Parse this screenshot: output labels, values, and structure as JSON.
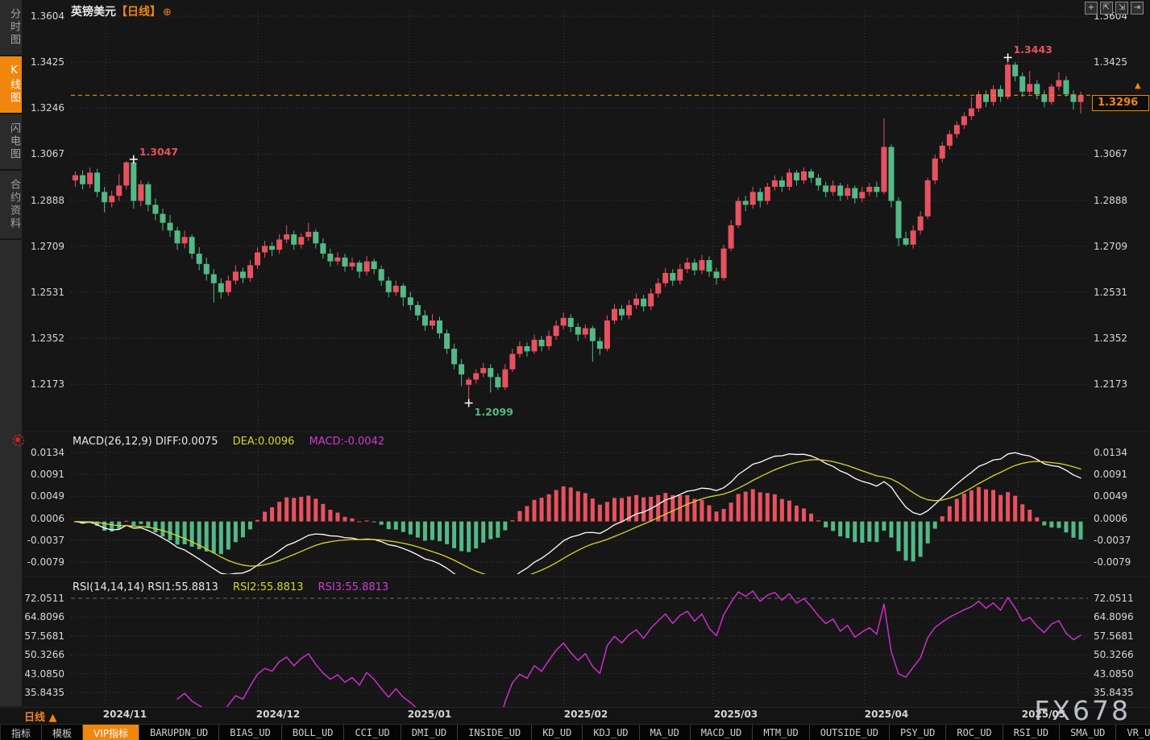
{
  "app": {
    "watermark": "FX678"
  },
  "colors": {
    "background": "#161616",
    "up": "#e8515f",
    "down": "#53b987",
    "accent_orange": "#f0860d",
    "dea_yellow": "#d6d62a",
    "magenta": "#cc2ecc",
    "diff_white": "#ffffff",
    "grid": "#3d3d3d",
    "axis_text": "#d8d8d8",
    "watermark": "#c9ced6"
  },
  "sidebar": {
    "tabs": [
      {
        "label": "分时图",
        "active": false
      },
      {
        "label": "K线图",
        "active": true
      },
      {
        "label": "闪电图",
        "active": false
      },
      {
        "label": "合约资料",
        "active": false
      }
    ]
  },
  "header": {
    "symbol": "英镑美元",
    "period_tag": "【日线】",
    "add_icon": "⊕"
  },
  "topbar_icons": [
    {
      "name": "crosshair-move-icon",
      "glyph": "+"
    },
    {
      "name": "zoom-axis-left-icon",
      "glyph": "⇱"
    },
    {
      "name": "zoom-axis-right-icon",
      "glyph": "⇲"
    },
    {
      "name": "exit-chart-icon",
      "glyph": "⇥"
    }
  ],
  "price_axis": {
    "ticks": [
      "1.3604",
      "1.3425",
      "1.3246",
      "1.3067",
      "1.2888",
      "1.2709",
      "1.2531",
      "1.2352",
      "1.2173"
    ]
  },
  "macd_panel": {
    "label_main": "MACD(26,12,9) DIFF:0.0075",
    "label_dea": "DEA:0.0096",
    "label_macd": "MACD:-0.0042",
    "ticks": [
      "0.0134",
      "0.0091",
      "0.0049",
      "0.0006",
      "-0.0037",
      "-0.0079"
    ]
  },
  "rsi_panel": {
    "label_main": "RSI(14,14,14) RSI1:55.8813",
    "label_rsi2": "RSI2:55.8813",
    "label_rsi3": "RSI3:55.8813",
    "ticks": [
      "72.0511",
      "64.8096",
      "57.5681",
      "50.3266",
      "43.0850",
      "35.8435"
    ]
  },
  "time_axis": {
    "period_label": "日线",
    "period_arrow": "▲",
    "dates": [
      "2024/11",
      "2024/12",
      "2025/01",
      "2025/02",
      "2025/03",
      "2025/04",
      "2025/05"
    ]
  },
  "toolbar": {
    "buttons": [
      {
        "label": "指标",
        "cjk": true,
        "active": false
      },
      {
        "label": "模板",
        "cjk": true,
        "active": false
      },
      {
        "label": "VIP指标",
        "cjk": true,
        "active": true
      },
      {
        "label": "BARUPDN_UD"
      },
      {
        "label": "BIAS_UD"
      },
      {
        "label": "BOLL_UD"
      },
      {
        "label": "CCI_UD"
      },
      {
        "label": "DMI_UD"
      },
      {
        "label": "INSIDE_UD"
      },
      {
        "label": "KD_UD"
      },
      {
        "label": "KDJ_UD"
      },
      {
        "label": "MA_UD"
      },
      {
        "label": "MACD_UD"
      },
      {
        "label": "MTM_UD"
      },
      {
        "label": "OUTSIDE_UD"
      },
      {
        "label": "PSY_UD"
      },
      {
        "label": "ROC_UD"
      },
      {
        "label": "RSI_UD"
      },
      {
        "label": "SMA_UD"
      },
      {
        "label": "VR_UD"
      },
      {
        "label": ">>"
      }
    ]
  },
  "main_chart": {
    "last_price_label": "1.3296",
    "annotations": [
      {
        "text": "1.3047",
        "candle": 8,
        "anchor": "high",
        "color": "#e8515f"
      },
      {
        "text": "1.3443",
        "candle": 128,
        "anchor": "high",
        "color": "#e8515f"
      },
      {
        "text": "1.2099",
        "candle": 54,
        "anchor": "low",
        "color": "#53b987"
      }
    ]
  },
  "chart_data": {
    "type": "candlestick",
    "title": "英镑美元 GBP/USD 日线 (daily)",
    "x_range": [
      "2024/10 late",
      "2025/05 early"
    ],
    "price_axis_ticks": [
      1.3604,
      1.3425,
      1.3246,
      1.3067,
      1.2888,
      1.2709,
      1.2531,
      1.2352,
      1.2173
    ],
    "marked_high": 1.3443,
    "marked_low": 1.2099,
    "last_price": 1.3296,
    "legend_note": "red = up candle, green = down candle (CN convention)",
    "indicators": {
      "macd": {
        "params": [
          26,
          12,
          9
        ],
        "diff": 0.0075,
        "dea": 0.0096,
        "macd": -0.0042,
        "axis_ticks": [
          0.0134,
          0.0091,
          0.0049,
          0.0006,
          -0.0037,
          -0.0079
        ]
      },
      "rsi": {
        "params": [
          14,
          14,
          14
        ],
        "rsi1": 55.8813,
        "rsi2": 55.8813,
        "rsi3": 55.8813,
        "axis_ticks": [
          72.0511,
          64.8096,
          57.5681,
          50.3266,
          43.085,
          35.8435
        ]
      }
    },
    "candles_format": [
      "open",
      "high",
      "low",
      "close"
    ],
    "candles": [
      [
        1.2965,
        1.3,
        1.294,
        1.2985
      ],
      [
        1.2985,
        1.3005,
        1.293,
        1.295
      ],
      [
        1.295,
        1.3015,
        1.2935,
        1.2995
      ],
      [
        1.2995,
        1.301,
        1.29,
        1.292
      ],
      [
        1.292,
        1.294,
        1.284,
        1.288
      ],
      [
        1.288,
        1.2925,
        1.286,
        1.2905
      ],
      [
        1.2905,
        1.299,
        1.2885,
        1.2945
      ],
      [
        1.2945,
        1.304,
        1.293,
        1.3035
      ],
      [
        1.3035,
        1.3047,
        1.2855,
        1.2885
      ],
      [
        1.2885,
        1.2965,
        1.2865,
        1.295
      ],
      [
        1.295,
        1.296,
        1.2845,
        1.287
      ],
      [
        1.287,
        1.2895,
        1.281,
        1.2835
      ],
      [
        1.2835,
        1.2855,
        1.277,
        1.28
      ],
      [
        1.28,
        1.283,
        1.2745,
        1.277
      ],
      [
        1.277,
        1.2785,
        1.2695,
        1.272
      ],
      [
        1.272,
        1.277,
        1.27,
        1.2745
      ],
      [
        1.2745,
        1.2755,
        1.266,
        1.268
      ],
      [
        1.268,
        1.2705,
        1.2615,
        1.264
      ],
      [
        1.264,
        1.2665,
        1.2575,
        1.26
      ],
      [
        1.26,
        1.262,
        1.249,
        1.2565
      ],
      [
        1.2565,
        1.2585,
        1.2505,
        1.253
      ],
      [
        1.253,
        1.2595,
        1.2515,
        1.2575
      ],
      [
        1.2575,
        1.2635,
        1.256,
        1.261
      ],
      [
        1.261,
        1.2625,
        1.2565,
        1.2585
      ],
      [
        1.2585,
        1.2655,
        1.257,
        1.2635
      ],
      [
        1.2635,
        1.2705,
        1.262,
        1.2685
      ],
      [
        1.2685,
        1.273,
        1.2665,
        1.271
      ],
      [
        1.271,
        1.2725,
        1.267,
        1.2695
      ],
      [
        1.2695,
        1.2755,
        1.268,
        1.2735
      ],
      [
        1.2735,
        1.279,
        1.272,
        1.2755
      ],
      [
        1.2755,
        1.277,
        1.2695,
        1.2715
      ],
      [
        1.2715,
        1.276,
        1.27,
        1.2745
      ],
      [
        1.2745,
        1.28,
        1.273,
        1.2765
      ],
      [
        1.2765,
        1.2775,
        1.27,
        1.272
      ],
      [
        1.272,
        1.274,
        1.266,
        1.268
      ],
      [
        1.268,
        1.27,
        1.263,
        1.265
      ],
      [
        1.265,
        1.2685,
        1.2635,
        1.2665
      ],
      [
        1.2665,
        1.268,
        1.261,
        1.263
      ],
      [
        1.263,
        1.2665,
        1.2615,
        1.2645
      ],
      [
        1.2645,
        1.2655,
        1.2585,
        1.261
      ],
      [
        1.261,
        1.267,
        1.2595,
        1.265
      ],
      [
        1.265,
        1.266,
        1.26,
        1.262
      ],
      [
        1.262,
        1.2635,
        1.2555,
        1.2575
      ],
      [
        1.2575,
        1.259,
        1.251,
        1.253
      ],
      [
        1.253,
        1.2575,
        1.2515,
        1.2555
      ],
      [
        1.2555,
        1.2565,
        1.2475,
        1.251
      ],
      [
        1.251,
        1.253,
        1.246,
        1.248
      ],
      [
        1.248,
        1.2495,
        1.242,
        1.244
      ],
      [
        1.244,
        1.246,
        1.238,
        1.24
      ],
      [
        1.24,
        1.2445,
        1.2385,
        1.242
      ],
      [
        1.242,
        1.2435,
        1.235,
        1.237
      ],
      [
        1.237,
        1.2385,
        1.229,
        1.231
      ],
      [
        1.231,
        1.233,
        1.223,
        1.225
      ],
      [
        1.225,
        1.227,
        1.2165,
        1.221
      ],
      [
        1.217,
        1.22,
        1.2099,
        1.219
      ],
      [
        1.219,
        1.223,
        1.2175,
        1.2215
      ],
      [
        1.2215,
        1.2255,
        1.22,
        1.2235
      ],
      [
        1.2235,
        1.225,
        1.214,
        1.22
      ],
      [
        1.22,
        1.2215,
        1.215,
        1.216
      ],
      [
        1.216,
        1.225,
        1.215,
        1.223
      ],
      [
        1.223,
        1.231,
        1.222,
        1.229
      ],
      [
        1.229,
        1.234,
        1.2275,
        1.232
      ],
      [
        1.232,
        1.2335,
        1.228,
        1.23
      ],
      [
        1.23,
        1.2365,
        1.229,
        1.2345
      ],
      [
        1.2345,
        1.236,
        1.23,
        1.232
      ],
      [
        1.232,
        1.238,
        1.2305,
        1.236
      ],
      [
        1.236,
        1.242,
        1.2345,
        1.24
      ],
      [
        1.24,
        1.245,
        1.2385,
        1.243
      ],
      [
        1.243,
        1.2445,
        1.2375,
        1.2395
      ],
      [
        1.2395,
        1.241,
        1.234,
        1.2365
      ],
      [
        1.2365,
        1.2405,
        1.235,
        1.239
      ],
      [
        1.239,
        1.24,
        1.226,
        1.234
      ],
      [
        1.234,
        1.2355,
        1.2285,
        1.231
      ],
      [
        1.231,
        1.244,
        1.23,
        1.242
      ],
      [
        1.242,
        1.2485,
        1.2405,
        1.2465
      ],
      [
        1.2465,
        1.248,
        1.242,
        1.244
      ],
      [
        1.244,
        1.25,
        1.2425,
        1.248
      ],
      [
        1.248,
        1.2525,
        1.2465,
        1.2505
      ],
      [
        1.2505,
        1.252,
        1.2455,
        1.2475
      ],
      [
        1.2475,
        1.2545,
        1.246,
        1.2525
      ],
      [
        1.2525,
        1.2585,
        1.251,
        1.2565
      ],
      [
        1.2565,
        1.2625,
        1.255,
        1.2605
      ],
      [
        1.2605,
        1.262,
        1.2555,
        1.2575
      ],
      [
        1.2575,
        1.264,
        1.256,
        1.262
      ],
      [
        1.262,
        1.2665,
        1.2605,
        1.2645
      ],
      [
        1.2645,
        1.266,
        1.2595,
        1.2615
      ],
      [
        1.2615,
        1.2675,
        1.26,
        1.2655
      ],
      [
        1.2655,
        1.267,
        1.259,
        1.261
      ],
      [
        1.261,
        1.2625,
        1.256,
        1.2585
      ],
      [
        1.2585,
        1.2715,
        1.2575,
        1.27
      ],
      [
        1.27,
        1.281,
        1.269,
        1.279
      ],
      [
        1.279,
        1.29,
        1.278,
        1.2885
      ],
      [
        1.2885,
        1.2905,
        1.2845,
        1.287
      ],
      [
        1.287,
        1.294,
        1.2855,
        1.292
      ],
      [
        1.292,
        1.2935,
        1.286,
        1.2885
      ],
      [
        1.2885,
        1.2955,
        1.287,
        1.294
      ],
      [
        1.294,
        1.2985,
        1.2925,
        1.2965
      ],
      [
        1.2965,
        1.298,
        1.292,
        1.294
      ],
      [
        1.294,
        1.301,
        1.2925,
        1.2995
      ],
      [
        1.2995,
        1.3005,
        1.2945,
        1.2965
      ],
      [
        1.2965,
        1.3015,
        1.295,
        1.3
      ],
      [
        1.3,
        1.301,
        1.2955,
        1.2975
      ],
      [
        1.2975,
        1.299,
        1.2925,
        1.2945
      ],
      [
        1.2945,
        1.296,
        1.29,
        1.292
      ],
      [
        1.292,
        1.2965,
        1.2905,
        1.2945
      ],
      [
        1.2945,
        1.2955,
        1.2885,
        1.2905
      ],
      [
        1.2905,
        1.295,
        1.289,
        1.2935
      ],
      [
        1.2935,
        1.2945,
        1.2875,
        1.2895
      ],
      [
        1.2895,
        1.294,
        1.288,
        1.292
      ],
      [
        1.292,
        1.2955,
        1.2905,
        1.294
      ],
      [
        1.294,
        1.296,
        1.29,
        1.292
      ],
      [
        1.292,
        1.3207,
        1.291,
        1.3095
      ],
      [
        1.3095,
        1.3105,
        1.286,
        1.2885
      ],
      [
        1.2885,
        1.29,
        1.2709,
        1.274
      ],
      [
        1.274,
        1.2765,
        1.2709,
        1.2715
      ],
      [
        1.2715,
        1.279,
        1.27,
        1.277
      ],
      [
        1.277,
        1.2845,
        1.2755,
        1.2825
      ],
      [
        1.2825,
        1.2975,
        1.2815,
        1.2965
      ],
      [
        1.2965,
        1.3065,
        1.295,
        1.305
      ],
      [
        1.305,
        1.3115,
        1.3035,
        1.31
      ],
      [
        1.31,
        1.316,
        1.3085,
        1.3145
      ],
      [
        1.3145,
        1.3195,
        1.313,
        1.318
      ],
      [
        1.318,
        1.323,
        1.3165,
        1.3215
      ],
      [
        1.3215,
        1.329,
        1.32,
        1.3245
      ],
      [
        1.3245,
        1.3315,
        1.323,
        1.33
      ],
      [
        1.33,
        1.3315,
        1.325,
        1.327
      ],
      [
        1.327,
        1.3335,
        1.3255,
        1.332
      ],
      [
        1.332,
        1.3335,
        1.327,
        1.329
      ],
      [
        1.329,
        1.3443,
        1.328,
        1.3415
      ],
      [
        1.3415,
        1.3425,
        1.335,
        1.337
      ],
      [
        1.337,
        1.3385,
        1.329,
        1.331
      ],
      [
        1.331,
        1.339,
        1.33,
        1.334
      ],
      [
        1.334,
        1.3355,
        1.328,
        1.33
      ],
      [
        1.33,
        1.3315,
        1.325,
        1.327
      ],
      [
        1.327,
        1.334,
        1.326,
        1.333
      ],
      [
        1.333,
        1.3385,
        1.3315,
        1.3355
      ],
      [
        1.3355,
        1.337,
        1.329,
        1.33
      ],
      [
        1.33,
        1.3315,
        1.324,
        1.327
      ],
      [
        1.327,
        1.331,
        1.3225,
        1.3296
      ]
    ]
  }
}
